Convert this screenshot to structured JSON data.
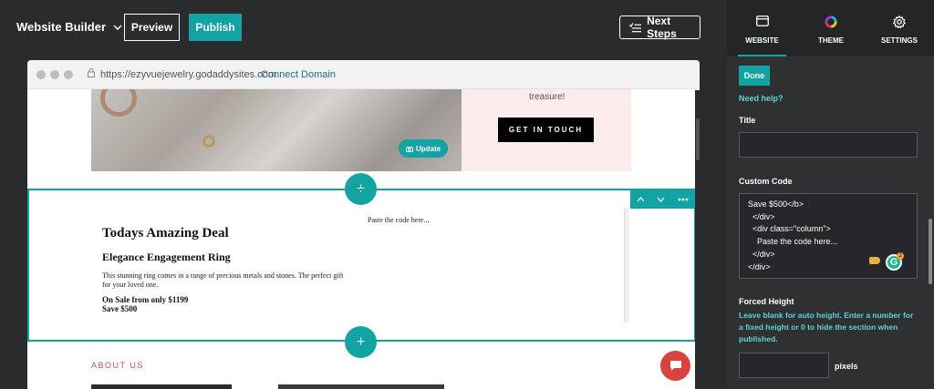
{
  "topbar": {
    "brand": "Website Builder",
    "preview_label": "Preview",
    "publish_label": "Publish",
    "next_steps_label": "Next Steps"
  },
  "browser": {
    "url": "https://ezyvuejewelry.godaddysites.com",
    "connect_domain": "Connect Domain"
  },
  "hero": {
    "update_label": "Update",
    "treasure_text": "treasure!",
    "get_in_touch": "GET IN TOUCH"
  },
  "section": {
    "paste_text": "Paste the code here...",
    "deal_title": "Todays Amazing Deal",
    "deal_subtitle": "Elegance Engagement Ring",
    "deal_description": "This stunning ring comes in a range of precious metals and stones. The perfect gift for your loved one.",
    "sale_line1": "On Sale from only $1199",
    "sale_line2": "Save $500"
  },
  "about_label": "ABOUT US",
  "panel": {
    "tabs": [
      {
        "label": "WEBSITE",
        "icon": "browser-icon"
      },
      {
        "label": "THEME",
        "icon": "theme-ring-icon"
      },
      {
        "label": "SETTINGS",
        "icon": "gear-icon"
      }
    ],
    "done_label": "Done",
    "need_help": "Need help?",
    "title_label": "Title",
    "title_value": "",
    "custom_code_label": "Custom Code",
    "code_lines": [
      "Save $500</b>",
      "  </div>",
      "  <div class=\"column\">",
      "    Paste the code here...",
      "  </div>",
      "</div>"
    ],
    "forced_height_label": "Forced Height",
    "forced_height_desc": "Leave blank for auto height. Enter a number for a fixed height or 0 to hide the section when published.",
    "pixels_label": "pixels",
    "grammarly_badge": "2"
  },
  "colors": {
    "accent": "#14a3a3",
    "dark_bg": "#2a2b2d",
    "chat": "#d9433f"
  }
}
